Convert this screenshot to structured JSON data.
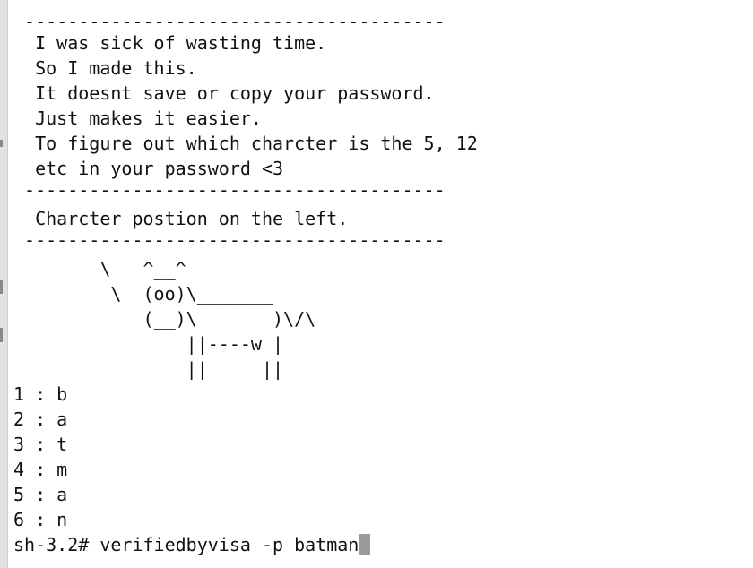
{
  "terminal": {
    "lines": [
      " ---------------------------------------",
      "  I was sick of wasting time.",
      "  So I made this.",
      "  It doesnt save or copy your password.",
      "  Just makes it easier.",
      "  To figure out which charcter is the 5, 12",
      "  etc in your password <3",
      " ---------------------------------------",
      "  Charcter postion on the left.",
      " ---------------------------------------",
      "        \\   ^__^",
      "         \\  (oo)\\_______",
      "            (__)\\       )\\/\\",
      "                ||----w |",
      "                ||     ||",
      "1 : b",
      "2 : a",
      "3 : t",
      "4 : m",
      "5 : a",
      "6 : n"
    ],
    "prompt": "sh-3.2# verifiedbyvisa -p batman"
  }
}
